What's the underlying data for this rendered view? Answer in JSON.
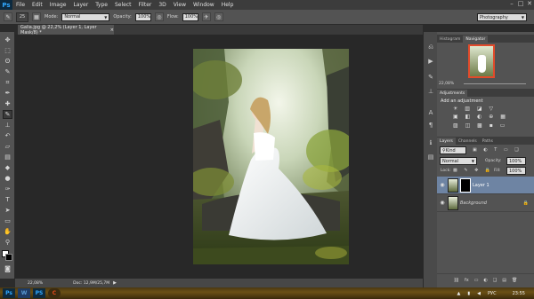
{
  "app": {
    "logo": "Ps"
  },
  "menu": [
    "File",
    "Edit",
    "Image",
    "Layer",
    "Type",
    "Select",
    "Filter",
    "3D",
    "View",
    "Window",
    "Help"
  ],
  "window_buttons": [
    "–",
    "□",
    "✕"
  ],
  "options_bar": {
    "brush_size": "25",
    "mode_label": "Mode:",
    "mode_value": "Normal",
    "opacity_label": "Opacity:",
    "opacity_value": "100%",
    "flow_label": "Flow:",
    "flow_value": "100%",
    "workspace": "Photography"
  },
  "document_tab": {
    "title": "Galia.jpg @ 22,2% (Layer 1, Layer Mask/8) *",
    "close": "×"
  },
  "status_bar": {
    "zoom": "22,08%",
    "doc": "Doc: 12,9M/25,7M"
  },
  "panels": {
    "navigator_tabs": [
      "Histogram",
      "Navigator"
    ],
    "navigator_zoom": "22,08%",
    "adjustments_tab": "Adjustments",
    "adjustments_title": "Add an adjustment",
    "layers_tabs": [
      "Layers",
      "Channels",
      "Paths"
    ],
    "kind_label": "Kind",
    "blend_mode": "Normal",
    "opacity_label": "Opacity:",
    "opacity_value": "100%",
    "lock_label": "Lock:",
    "fill_label": "Fill:",
    "fill_value": "100%",
    "layers": [
      {
        "name": "Layer 1",
        "selected": true
      },
      {
        "name": "Background",
        "selected": false
      }
    ],
    "bottom_icons": [
      "fx",
      "◐",
      "▭",
      "❑",
      "▤",
      "🗑"
    ]
  },
  "taskbar": {
    "items": [
      {
        "label": "Ps",
        "color": "#31a8ff"
      },
      {
        "label": "W",
        "color": "#5b9bd5"
      },
      {
        "label": "PS",
        "color": "#31a8ff"
      },
      {
        "label": "C",
        "color": "#e64a19"
      }
    ],
    "lang": "РУС",
    "time": "23:55"
  },
  "colors": {
    "accent": "#31a8ff",
    "selected_layer": "#6e84a3"
  }
}
